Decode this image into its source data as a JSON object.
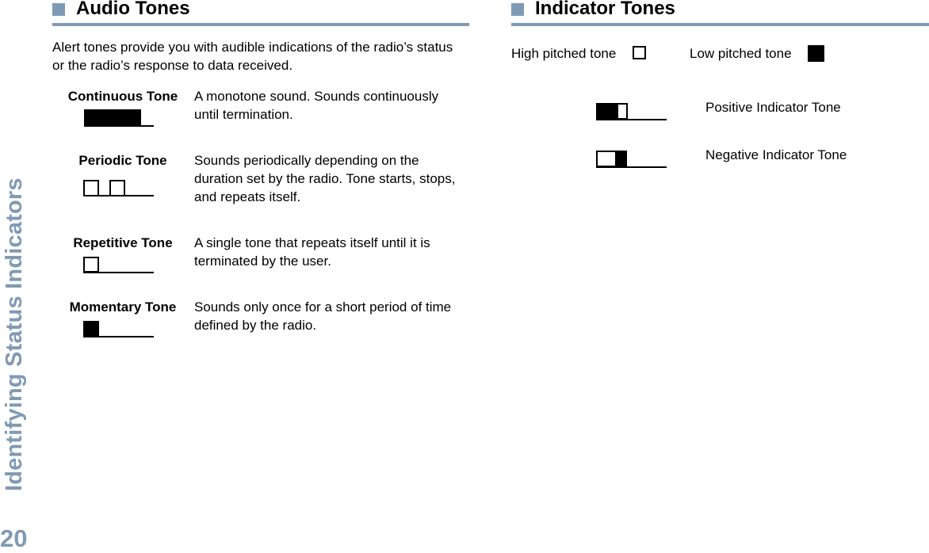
{
  "sidebar": {
    "chapter_title": "Identifying Status Indicators",
    "page_number": "20"
  },
  "accent_color": "#7f9ab4",
  "audio_tones": {
    "heading": "Audio Tones",
    "intro": "Alert tones provide you with audible indications of the radio’s status or the radio’s response to data received.",
    "tones": [
      {
        "name": "Continuous Tone",
        "description": "A monotone sound. Sounds continuously until termination.",
        "pattern": "continuous"
      },
      {
        "name": "Periodic Tone",
        "description": "Sounds periodically depending on the duration set by the radio. Tone starts, stops, and repeats itself.",
        "pattern": "periodic"
      },
      {
        "name": "Repetitive Tone",
        "description": "A single tone that repeats itself until it is terminated by the user.",
        "pattern": "repetitive"
      },
      {
        "name": "Momentary Tone",
        "description": "Sounds only once for a short period of time defined by the radio.",
        "pattern": "momentary"
      }
    ]
  },
  "indicator_tones": {
    "heading": "Indicator Tones",
    "legend": {
      "high": "High pitched tone",
      "low": "Low pitched tone"
    },
    "tones": [
      {
        "name": "Positive Indicator Tone",
        "pattern": "low-then-high"
      },
      {
        "name": "Negative Indicator Tone",
        "pattern": "high-then-low"
      }
    ]
  }
}
